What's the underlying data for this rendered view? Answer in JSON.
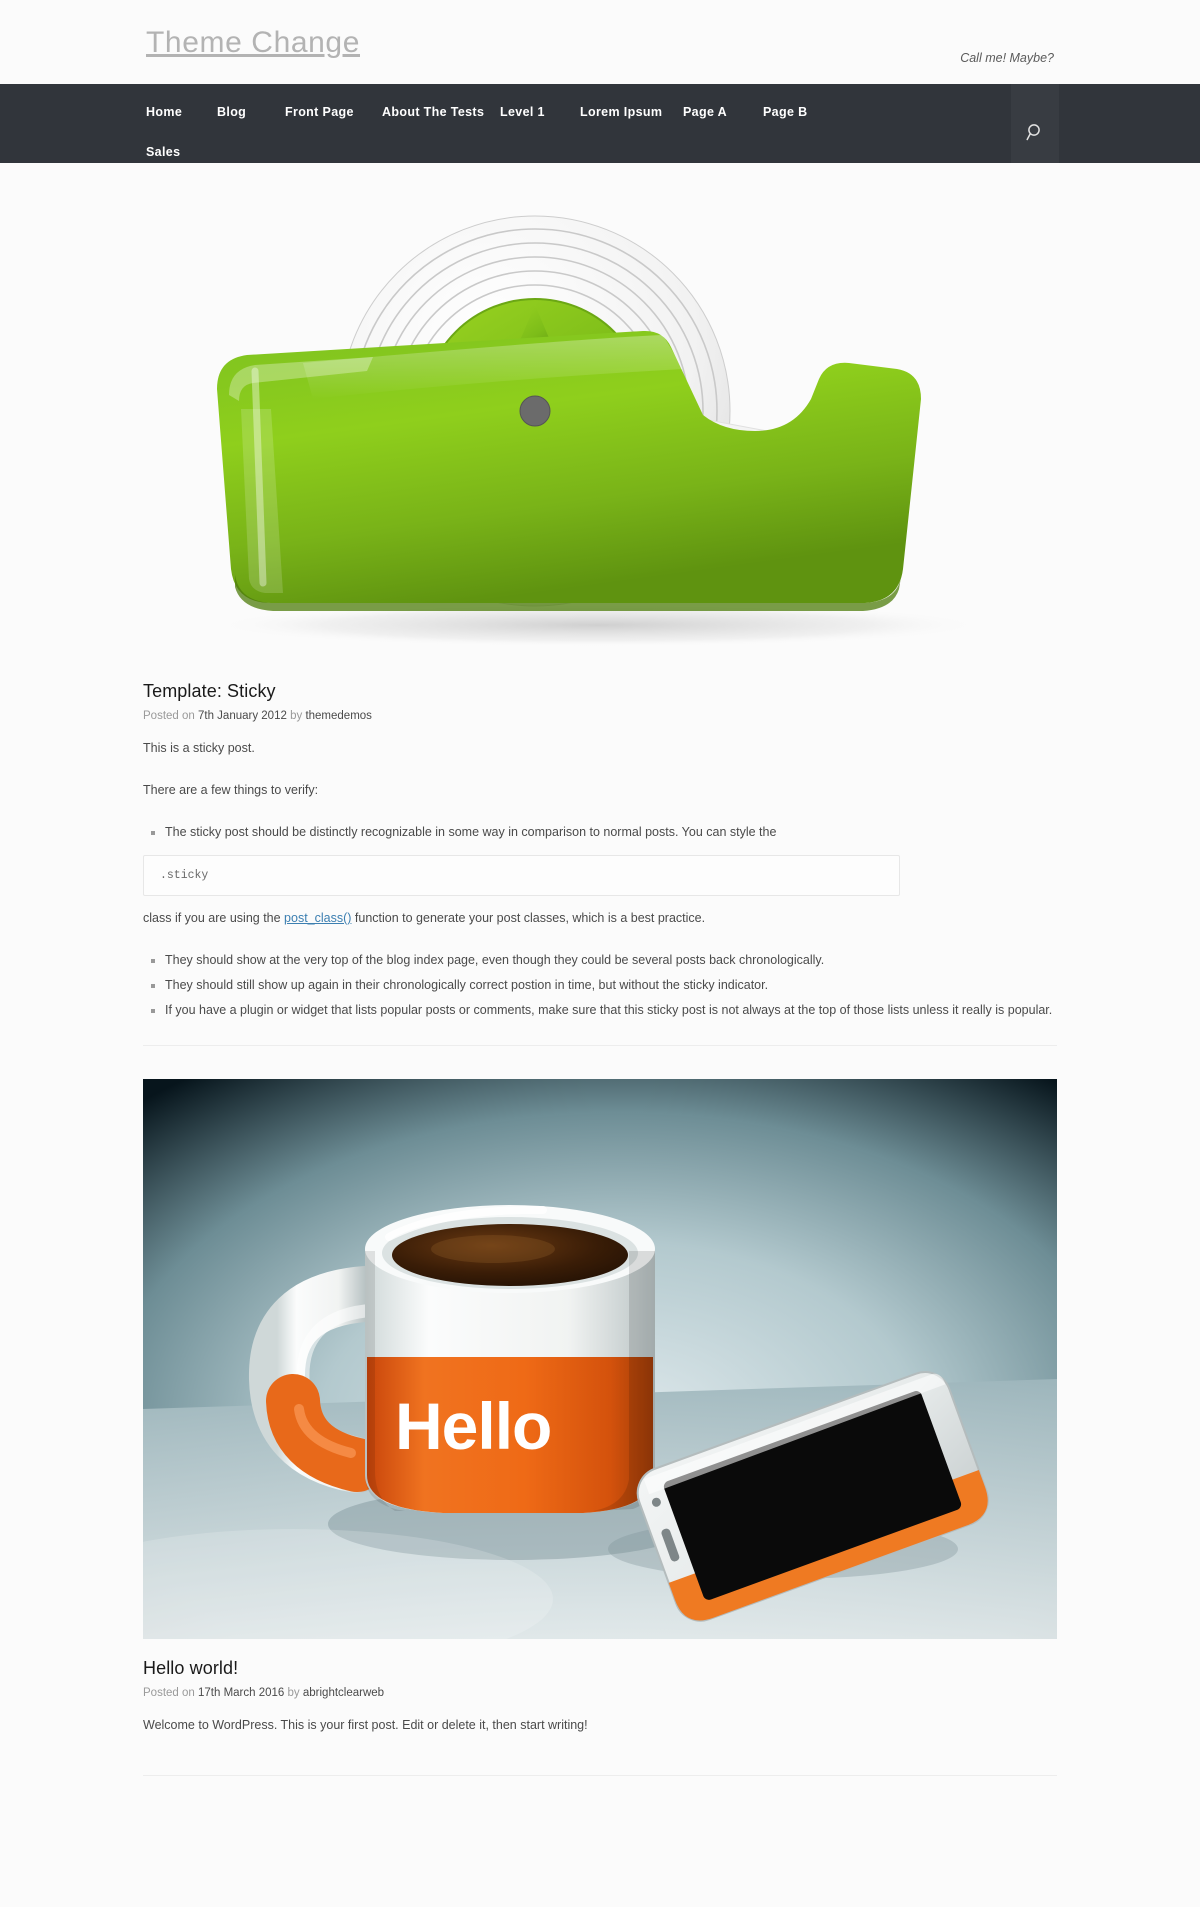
{
  "site": {
    "title": "Theme Change",
    "description": "Call me! Maybe?"
  },
  "nav": {
    "search_icon": "search-icon",
    "items": [
      {
        "label": "Home"
      },
      {
        "label": "Blog"
      },
      {
        "label": "Front Page"
      },
      {
        "label": "About The Tests"
      },
      {
        "label": "Level 1"
      },
      {
        "label": "Lorem Ipsum"
      },
      {
        "label": "Page A"
      },
      {
        "label": "Page B"
      },
      {
        "label": "Sales"
      }
    ]
  },
  "posts": [
    {
      "featured_image": "tape-dispenser-image",
      "title": "Template: Sticky",
      "meta": {
        "prefix": "Posted on",
        "date": "7th January 2012",
        "by": "by",
        "author": "themedemos"
      },
      "paragraphs": [
        "This is a sticky post.",
        "There are a few things to verify:"
      ],
      "list_items": [
        "The sticky post should be distinctly recognizable in some way in comparison to normal posts. You can style the",
        "They should show at the very top of the blog index page, even though they could be several posts back chronologically.",
        "They should still show up again in their chronologically correct postion in time, but without the sticky indicator.",
        "If you have a plugin or widget that lists popular posts or comments, make sure that this sticky post is not always at the top of those lists unless it really is popular."
      ],
      "code": ".sticky",
      "after_code_before_link": "class if you are using the ",
      "after_code_link": "post_class()",
      "after_code_after_link": " function to generate your post classes, which is a best practice."
    },
    {
      "featured_image": "coffee-mug-and-phone-image",
      "title": "Hello world!",
      "meta": {
        "prefix": "Posted on",
        "date": "17th March 2016",
        "by": "by",
        "author": "abrightclearweb"
      },
      "paragraphs": [
        "Welcome to WordPress. This is your first post. Edit or delete it, then start writing!"
      ]
    }
  ],
  "colors": {
    "nav_background": "#31353b",
    "page_background": "#fbfbfb",
    "link": "#3c7fb1",
    "title_gray": "#b3b3b3",
    "body_text": "#4a4a4a"
  }
}
